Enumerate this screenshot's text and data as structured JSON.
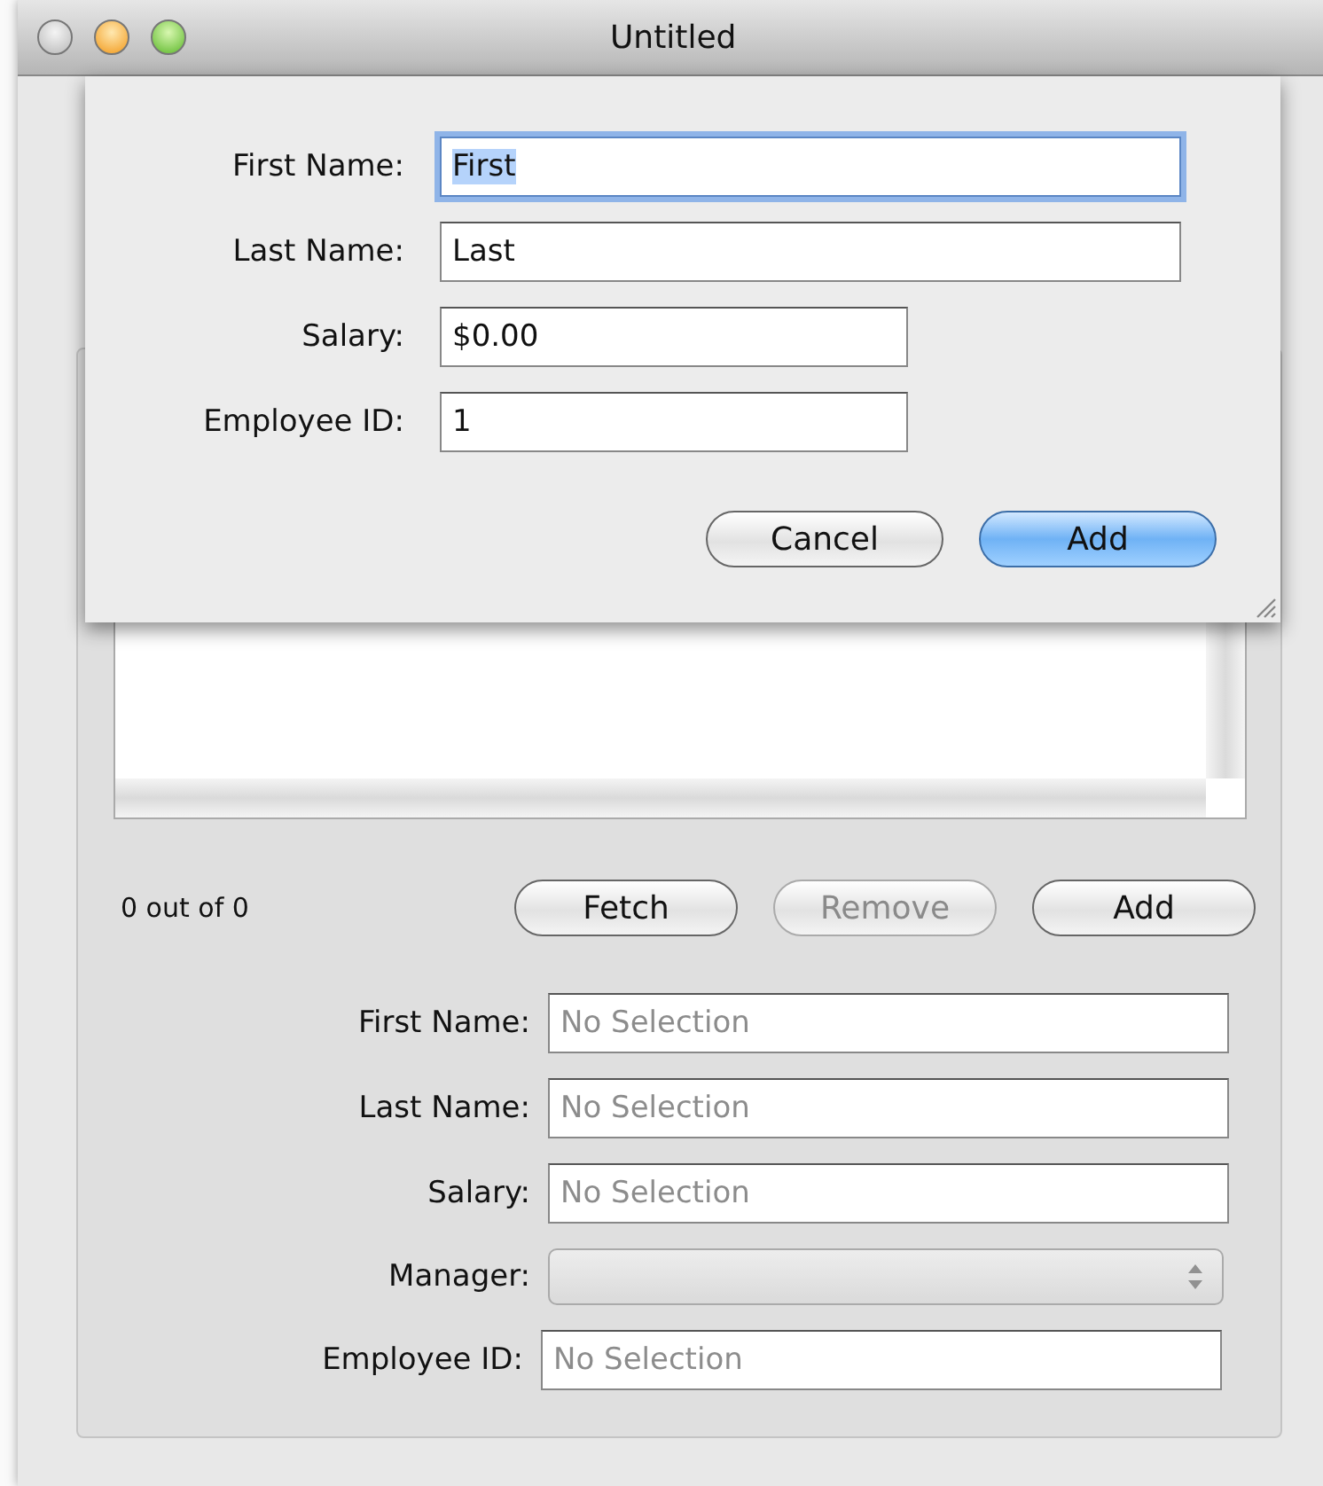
{
  "window": {
    "title": "Untitled",
    "buttons": [
      {
        "kind": "close",
        "disabled": true
      },
      {
        "kind": "minimize",
        "disabled": false
      },
      {
        "kind": "zoom",
        "disabled": false
      }
    ]
  },
  "sheet": {
    "fields": [
      {
        "label": "First Name:",
        "value": "First",
        "kind": "wide",
        "focused": true
      },
      {
        "label": "Last Name:",
        "value": "Last",
        "kind": "wide",
        "focused": false
      },
      {
        "label": "Salary:",
        "value": "$0.00",
        "kind": "narrow",
        "focused": false
      },
      {
        "label": "Employee ID:",
        "value": "1",
        "kind": "narrow",
        "focused": false
      }
    ],
    "buttons": [
      {
        "label": "Cancel",
        "default": false
      },
      {
        "label": "Add",
        "default": true
      }
    ]
  },
  "employees": {
    "count": "0 out of 0",
    "buttons": [
      {
        "label": "Fetch",
        "disabled": false
      },
      {
        "label": "Remove",
        "disabled": true
      },
      {
        "label": "Add",
        "disabled": false
      }
    ],
    "details": [
      {
        "kind": "text",
        "label": "First Name:",
        "placeholder": "No Selection"
      },
      {
        "kind": "text",
        "label": "Last Name:",
        "placeholder": "No Selection"
      },
      {
        "kind": "text",
        "label": "Salary:",
        "placeholder": "No Selection"
      },
      {
        "kind": "popup",
        "label": "Manager:",
        "disabled": true
      },
      {
        "kind": "text",
        "label": "Employee ID:",
        "placeholder": "No Selection"
      }
    ]
  }
}
